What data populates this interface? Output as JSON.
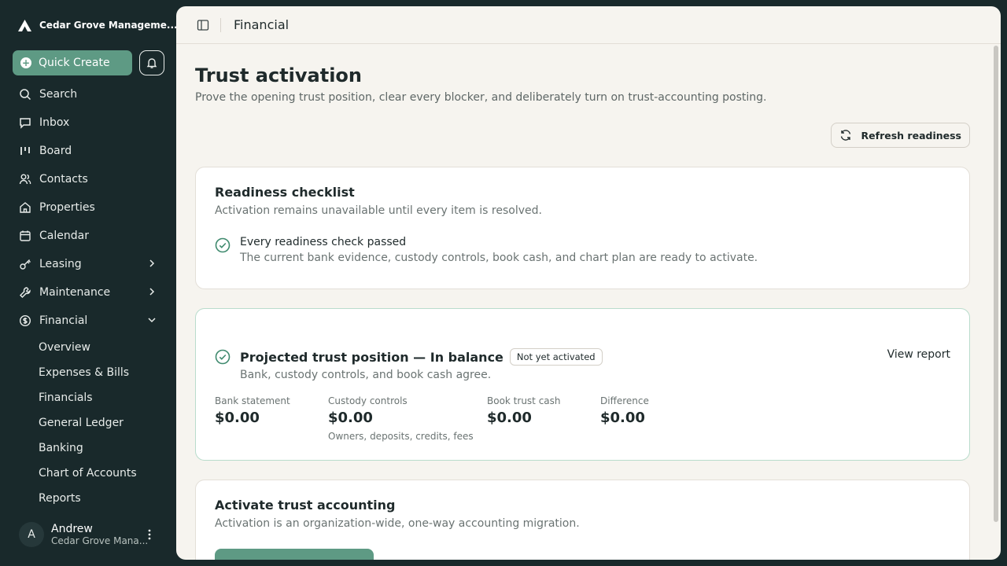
{
  "sidebar": {
    "org_name": "Cedar Grove Manageme...",
    "quick_create_label": "Quick Create",
    "items": [
      {
        "label": "Search"
      },
      {
        "label": "Inbox"
      },
      {
        "label": "Board"
      },
      {
        "label": "Contacts"
      },
      {
        "label": "Properties"
      },
      {
        "label": "Calendar"
      },
      {
        "label": "Leasing"
      },
      {
        "label": "Maintenance"
      },
      {
        "label": "Financial"
      }
    ],
    "financial_sub": [
      {
        "label": "Overview"
      },
      {
        "label": "Expenses & Bills"
      },
      {
        "label": "Financials"
      },
      {
        "label": "General Ledger"
      },
      {
        "label": "Banking"
      },
      {
        "label": "Chart of Accounts"
      },
      {
        "label": "Reports"
      }
    ],
    "user": {
      "initial": "A",
      "name": "Andrew",
      "org": "Cedar Grove Mana..."
    }
  },
  "header": {
    "title": "Financial"
  },
  "page": {
    "title": "Trust activation",
    "subtitle": "Prove the opening trust position, clear every blocker, and deliberately turn on trust-accounting posting.",
    "refresh_label": "Refresh readiness"
  },
  "checklist": {
    "title": "Readiness checklist",
    "subtitle": "Activation remains unavailable until every item is resolved.",
    "item_title": "Every readiness check passed",
    "item_desc": "The current bank evidence, custody controls, book cash, and chart plan are ready to activate."
  },
  "position": {
    "title": "Projected trust position — In balance",
    "badge": "Not yet activated",
    "desc": "Bank, custody controls, and book cash agree.",
    "view_report": "View report",
    "metrics": [
      {
        "label": "Bank statement",
        "value": "$0.00",
        "note": ""
      },
      {
        "label": "Custody controls",
        "value": "$0.00",
        "note": "Owners, deposits, credits, fees"
      },
      {
        "label": "Book trust cash",
        "value": "$0.00",
        "note": ""
      },
      {
        "label": "Difference",
        "value": "$0.00",
        "note": ""
      }
    ]
  },
  "activate": {
    "title": "Activate trust accounting",
    "subtitle": "Activation is an organization-wide, one-way accounting migration."
  },
  "colors": {
    "accent": "#5e9a84",
    "sidebar_bg": "#19292b",
    "main_bg": "#f6f4ef"
  }
}
